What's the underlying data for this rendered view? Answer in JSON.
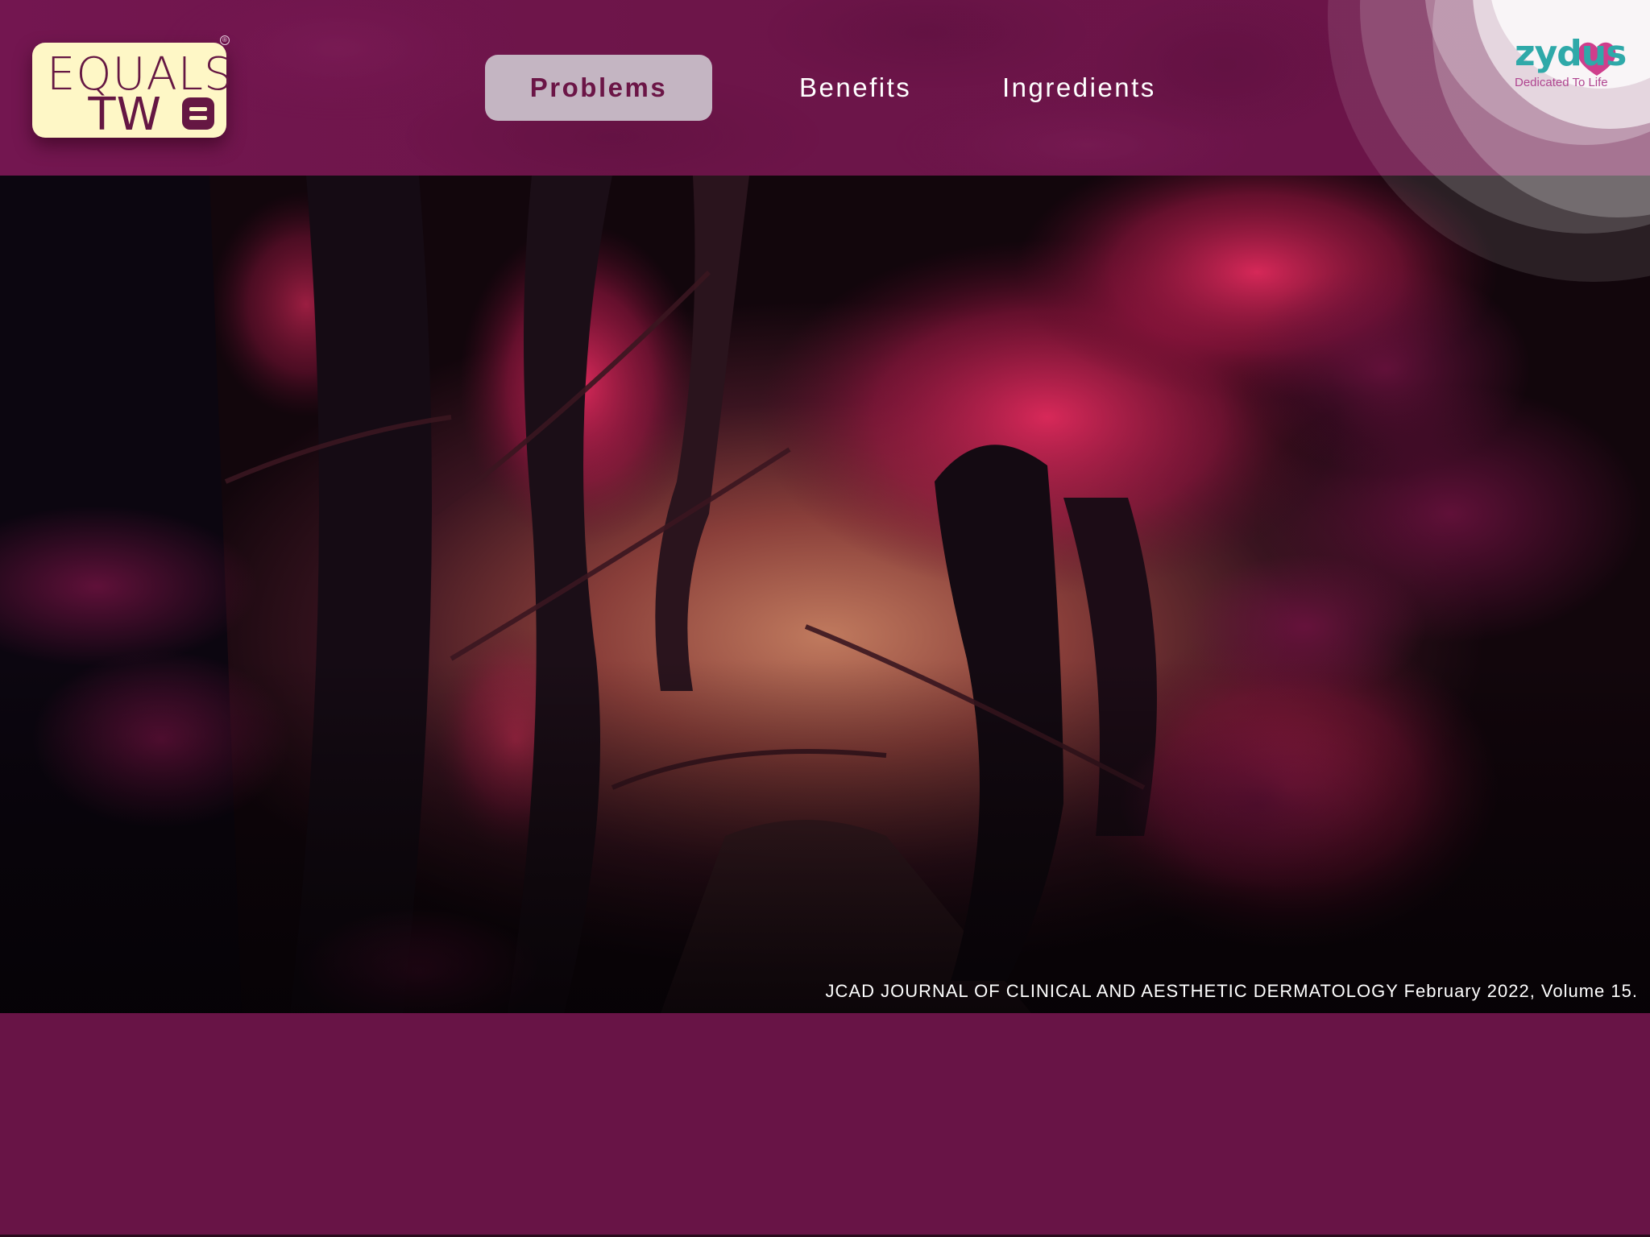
{
  "logo": {
    "line1": "EQUALS",
    "line2": "TW",
    "registered": "®"
  },
  "nav": {
    "items": [
      {
        "label": "Problems",
        "active": true
      },
      {
        "label": "Benefits",
        "active": false
      },
      {
        "label": "Ingredients",
        "active": false
      }
    ]
  },
  "brand": {
    "name": "zydus",
    "tagline": "Dedicated To Life"
  },
  "hero": {
    "citation": "JCAD JOURNAL OF CLINICAL AND AESTHETIC DERMATOLOGY February 2022, Volume 15."
  },
  "colors": {
    "header_bg": "#731650",
    "page_bg": "#681446",
    "logo_bg": "#fef7c6",
    "logo_text": "#651743",
    "nav_active_bg": "#c4b5c2",
    "nav_active_text": "#6b1546",
    "brand_teal": "#2fa9a9",
    "brand_magenta": "#b04590"
  }
}
